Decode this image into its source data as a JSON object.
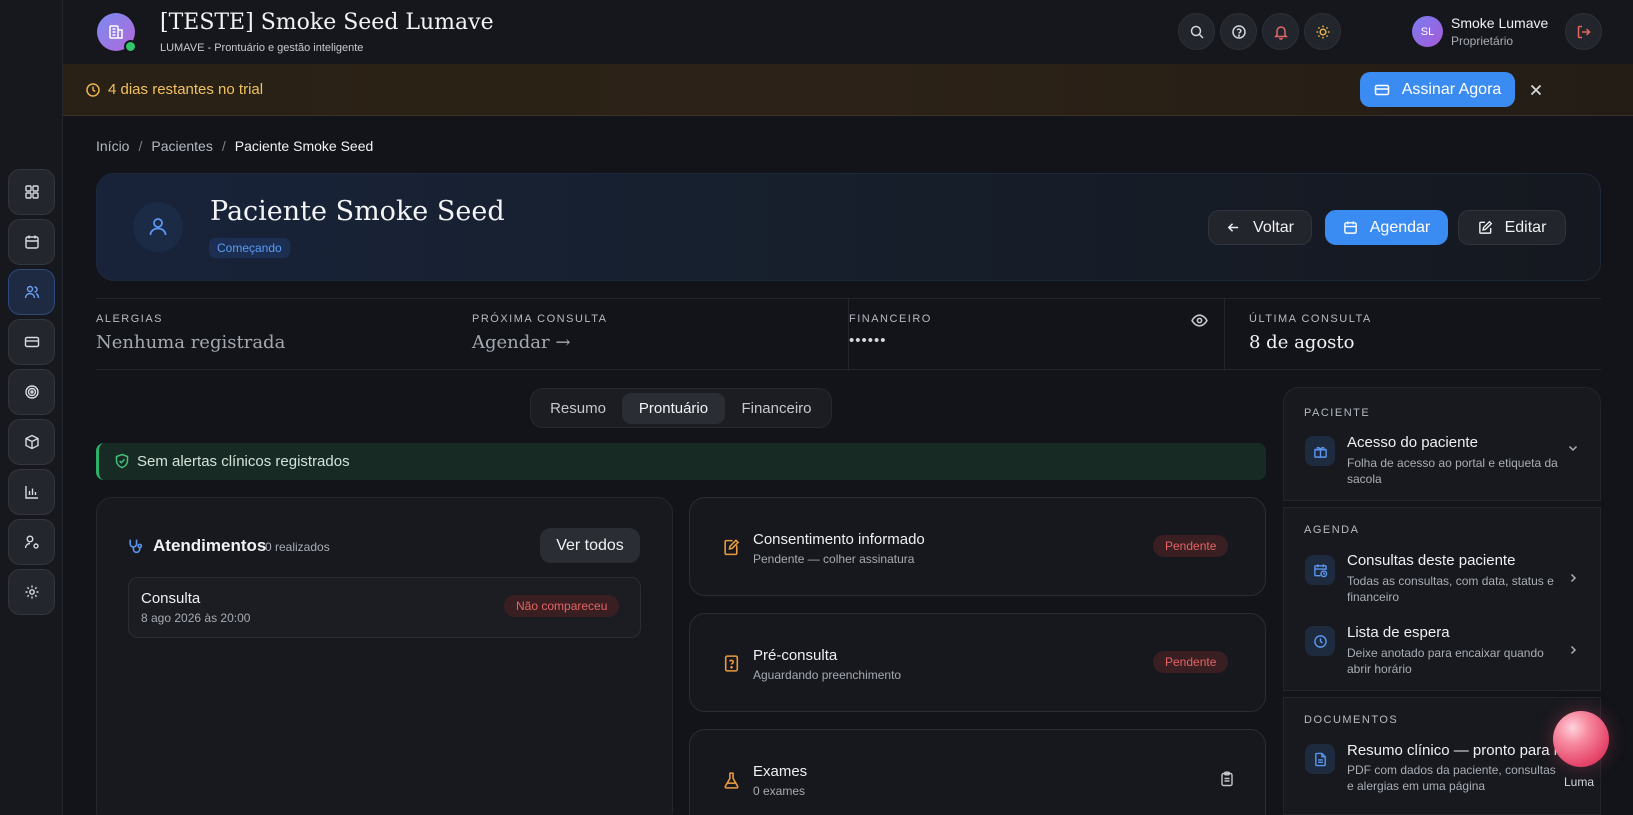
{
  "colors": {
    "background": "#121419",
    "accent": "#3b8cf2",
    "trial_text": "#f0c15c",
    "pending_red": "#e36464",
    "success_green": "#43c07a",
    "document_orange": "#e99a3e"
  },
  "sidebar": {
    "items": [
      {
        "icon": "dashboard-icon",
        "active": false
      },
      {
        "icon": "calendar-icon",
        "active": false
      },
      {
        "icon": "users-icon",
        "active": true
      },
      {
        "icon": "credit-card-icon",
        "active": false
      },
      {
        "icon": "target-icon",
        "active": false
      },
      {
        "icon": "package-icon",
        "active": false
      },
      {
        "icon": "bar-chart-icon",
        "active": false
      },
      {
        "icon": "user-settings-icon",
        "active": false
      },
      {
        "icon": "gear-icon",
        "active": false
      }
    ]
  },
  "header": {
    "title": "[TESTE] Smoke Seed Lumave",
    "subtitle": "LUMAVE - Prontuário e gestão inteligente",
    "user": {
      "initials": "SL",
      "name": "Smoke Lumave",
      "role": "Proprietário"
    }
  },
  "trial": {
    "message": "4 dias restantes no trial",
    "subscribe_label": "Assinar Agora"
  },
  "breadcrumb": {
    "items": [
      "Início",
      "Pacientes"
    ],
    "current": "Paciente Smoke Seed",
    "separator": "/"
  },
  "patient": {
    "name": "Paciente Smoke Seed",
    "status": "Começando",
    "actions": {
      "back": "Voltar",
      "schedule": "Agendar",
      "edit": "Editar"
    }
  },
  "info": {
    "allergies": {
      "label": "ALERGIAS",
      "value": "Nenhuma registrada"
    },
    "next_appointment": {
      "label": "PRÓXIMA CONSULTA",
      "value": "Agendar →"
    },
    "finance": {
      "label": "FINANCEIRO",
      "value": "••••••"
    },
    "last_appointment": {
      "label": "ÚLTIMA CONSULTA",
      "value": "8 de agosto"
    }
  },
  "tabs": [
    {
      "label": "Resumo",
      "active": false
    },
    {
      "label": "Prontuário",
      "active": true
    },
    {
      "label": "Financeiro",
      "active": false
    }
  ],
  "alert": {
    "text": "Sem alertas clínicos registrados"
  },
  "attendances": {
    "title": "Atendimentos",
    "count": "0 realizados",
    "see_all": "Ver todos",
    "items": [
      {
        "title": "Consulta",
        "date": "8 ago 2026 às 20:00",
        "status": "Não compareceu"
      }
    ]
  },
  "documents": [
    {
      "title": "Consentimento informado",
      "subtitle": "Pendente — colher assinatura",
      "status": "Pendente",
      "icon": "pen-document-icon"
    },
    {
      "title": "Pré-consulta",
      "subtitle": "Aguardando preenchimento",
      "status": "Pendente",
      "icon": "question-document-icon"
    },
    {
      "title": "Exames",
      "subtitle": "0 exames",
      "status": "",
      "icon": "flask-icon"
    }
  ],
  "right_panel": {
    "patient": {
      "label": "PACIENTE",
      "items": [
        {
          "title": "Acesso do paciente",
          "desc": "Folha de acesso ao portal e etiqueta da sacola",
          "icon": "gift-icon"
        }
      ]
    },
    "agenda": {
      "label": "AGENDA",
      "items": [
        {
          "title": "Consultas deste paciente",
          "desc": "Todas as consultas, com data, status e financeiro",
          "icon": "calendar-clock-icon"
        },
        {
          "title": "Lista de espera",
          "desc": "Deixe anotado para encaixar quando abrir horário",
          "icon": "clock-icon"
        }
      ]
    },
    "documents": {
      "label": "DOCUMENTOS",
      "items": [
        {
          "title": "Resumo clínico — pronto para le",
          "desc": "PDF com dados da paciente, consultas e alergias em uma página",
          "icon": "file-icon"
        }
      ]
    }
  },
  "assistant": {
    "label": "Luma"
  }
}
